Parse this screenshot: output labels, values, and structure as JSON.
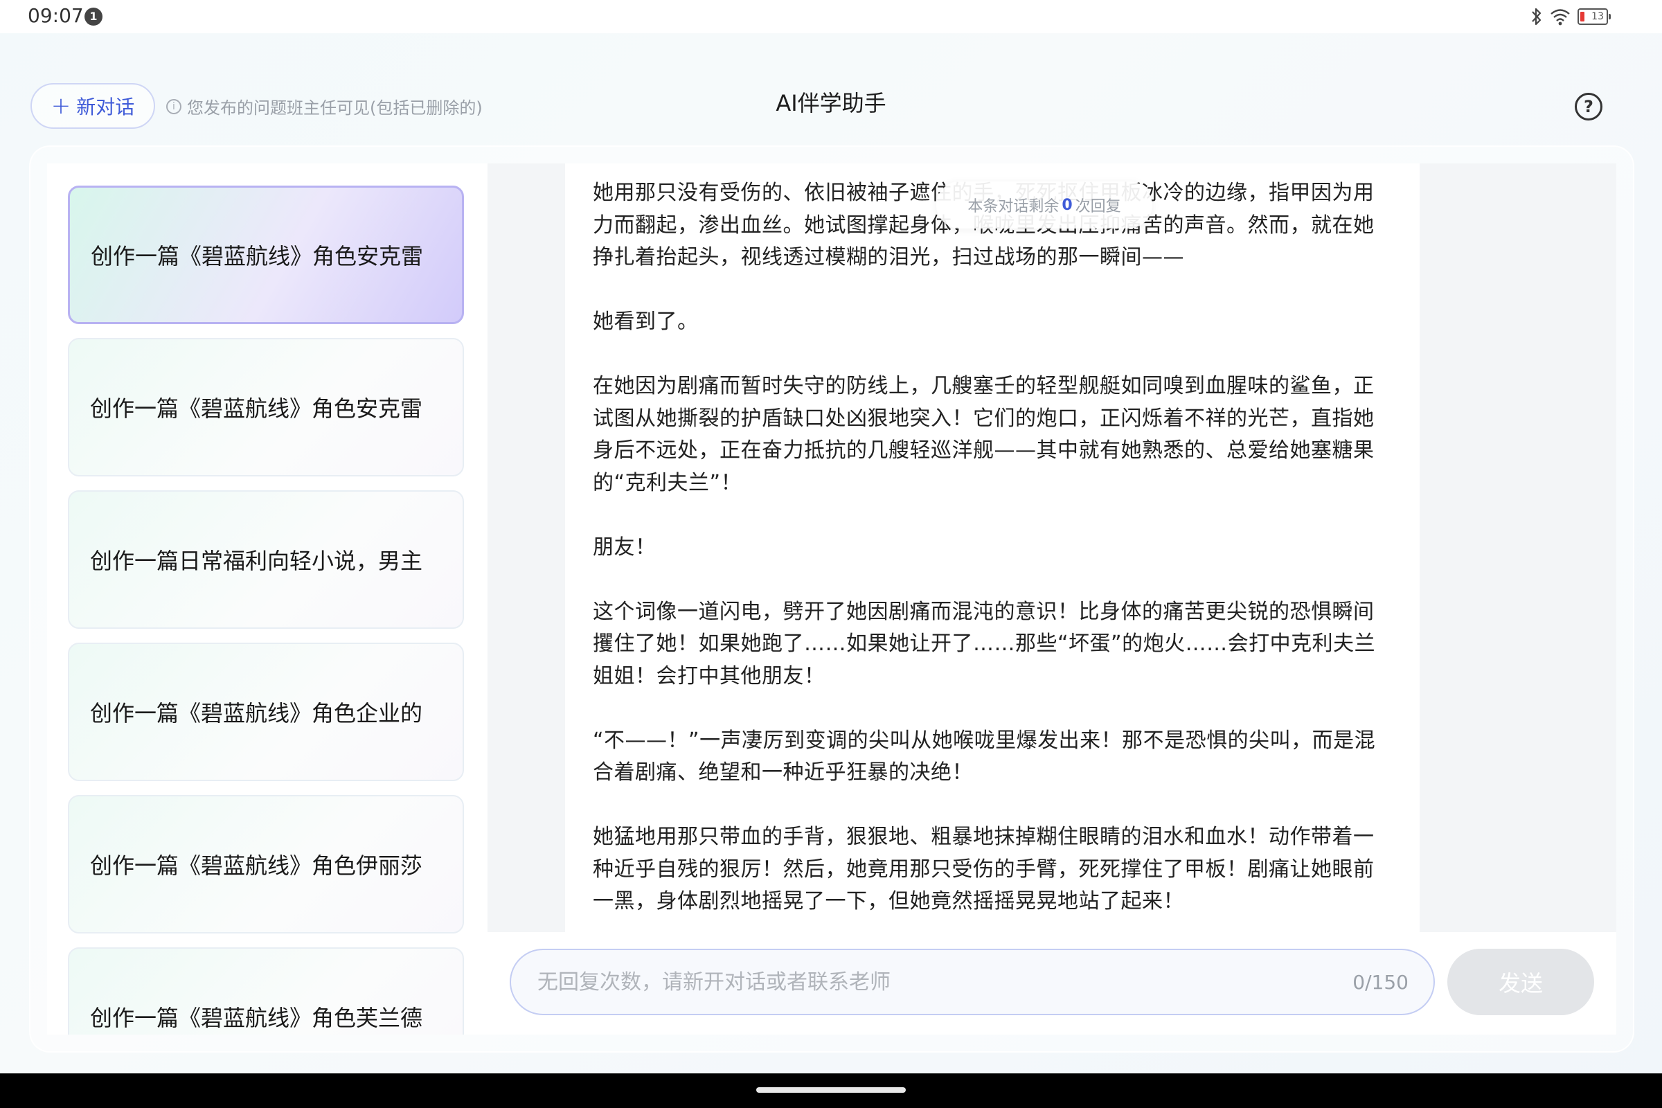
{
  "status_bar": {
    "time": "09:07",
    "notification_count": "1",
    "battery_level": "13"
  },
  "header": {
    "new_chat_label": "新对话",
    "notice": "您发布的问题班主任可见(包括已删除的)",
    "title": "AI伴学助手"
  },
  "sidebar": {
    "items": [
      {
        "label": "创作一篇《碧蓝航线》角色安克雷",
        "active": true
      },
      {
        "label": "创作一篇《碧蓝航线》角色安克雷",
        "active": false
      },
      {
        "label": "创作一篇日常福利向轻小说，男主",
        "active": false
      },
      {
        "label": "创作一篇《碧蓝航线》角色企业的",
        "active": false
      },
      {
        "label": "创作一篇《碧蓝航线》角色伊丽莎",
        "active": false
      },
      {
        "label": "创作一篇《碧蓝航线》角色芙兰德",
        "active": false
      }
    ]
  },
  "remaining": {
    "prefix": "本条对话剩余",
    "count": "0",
    "suffix": "次回复"
  },
  "message": {
    "paragraphs": [
      "她用那只没有受伤的、依旧被袖子遮住的手，死死抠住甲板冰冷的边缘，指甲因为用力而翻起，渗出血丝。她试图撑起身体，喉咙里发出压抑痛苦的声音。然而，就在她挣扎着抬起头，视线透过模糊的泪光，扫过战场的那一瞬间——",
      "她看到了。",
      "在她因为剧痛而暂时失守的防线上，几艘塞壬的轻型舰艇如同嗅到血腥味的鲨鱼，正试图从她撕裂的护盾缺口处凶狠地突入！它们的炮口，正闪烁着不祥的光芒，直指她身后不远处，正在奋力抵抗的几艘轻巡洋舰——其中就有她熟悉的、总爱给她塞糖果的“克利夫兰”！",
      "朋友！",
      "这个词像一道闪电，劈开了她因剧痛而混沌的意识！比身体的痛苦更尖锐的恐惧瞬间攫住了她！如果她跑了……如果她让开了……那些“坏蛋”的炮火……会打中克利夫兰姐姐！会打中其他朋友！",
      "“不——！”一声凄厉到变调的尖叫从她喉咙里爆发出来！那不是恐惧的尖叫，而是混合着剧痛、绝望和一种近乎狂暴的决绝！",
      "她猛地用那只带血的手背，狠狠地、粗暴地抹掉糊住眼睛的泪水和血水！动作带着一种近乎自残的狠厉！然后，她竟用那只受伤的手臂，死死撑住了甲板！剧痛让她眼前一黑，身体剧烈地摇晃了一下，但她竟然摇摇晃晃地站了起来！"
    ]
  },
  "input": {
    "placeholder": "无回复次数，请新开对话或者联系老师",
    "char_count": "0/150",
    "send_label": "发送"
  },
  "colors": {
    "accent": "#3f5bd8",
    "active_border": "#b8b2f2",
    "battery_low": "#e53935"
  }
}
